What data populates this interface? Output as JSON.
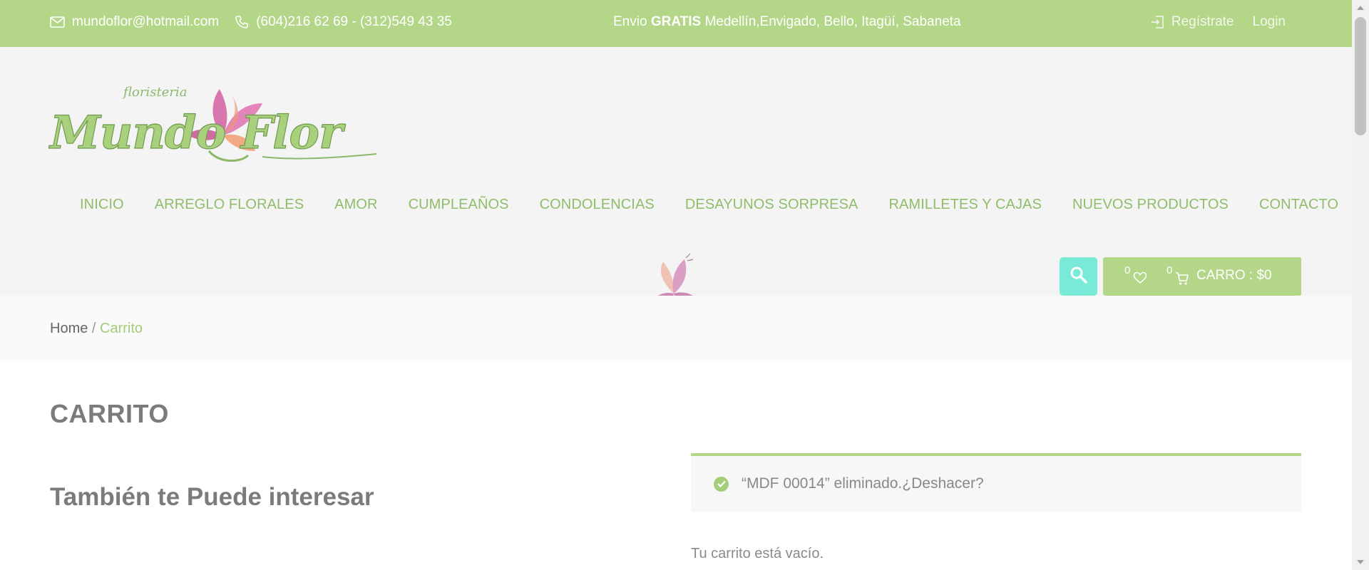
{
  "topbar": {
    "email": "mundoflor@hotmail.com",
    "phone": "(604)216 62 69 - (312)549 43 35",
    "shipping_prefix": "Envio ",
    "shipping_bold": "GRATIS",
    "shipping_suffix": " Medellín,Envigado, Bello, Itagüí, Sabaneta",
    "register": "Regístrate",
    "login": "Login"
  },
  "logo": {
    "top_text": "floristeria",
    "brand": "Mundo Flor"
  },
  "nav": [
    "INICIO",
    "ARREGLO FLORALES",
    "AMOR",
    "CUMPLEAÑOS",
    "CONDOLENCIAS",
    "DESAYUNOS SORPRESA",
    "RAMILLETES Y CAJAS",
    "NUEVOS PRODUCTOS",
    "CONTACTO"
  ],
  "cart": {
    "wishlist_count": "0",
    "cart_count": "0",
    "label": "CARRO : $0"
  },
  "breadcrumb": {
    "home": "Home",
    "separator": " / ",
    "current": "Carrito"
  },
  "page": {
    "title": "CARRITO",
    "interest_title": "También te Puede interesar",
    "notice_text": "“MDF 00014” eliminado. ",
    "notice_undo": "¿Deshacer?",
    "empty_text": "Tu carrito está vacío."
  },
  "colors": {
    "brand_green": "#b3d689",
    "nav_green": "#8fbd6a",
    "search_teal": "#79ead7"
  },
  "icons": {
    "email": "envelope-icon",
    "phone": "phone-icon",
    "register": "sign-in-icon",
    "search": "search-icon",
    "wishlist": "heart-icon",
    "cart": "cart-icon",
    "notice": "check-circle-icon"
  }
}
